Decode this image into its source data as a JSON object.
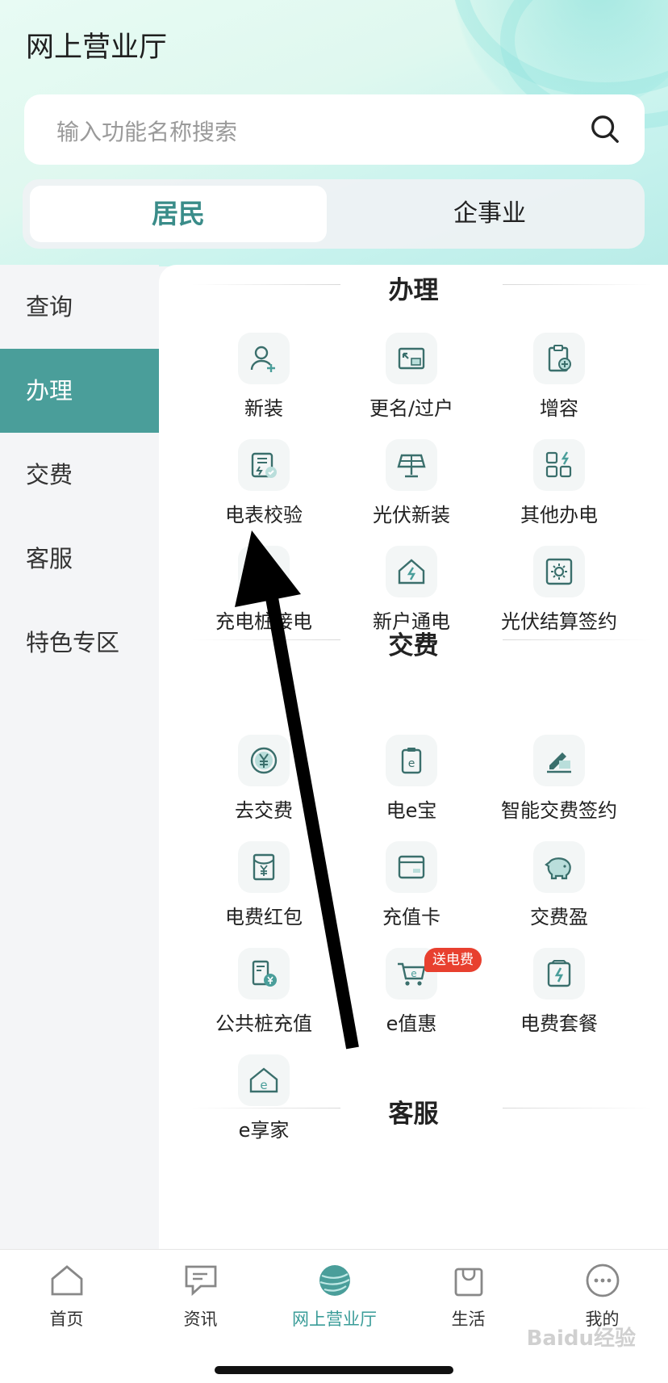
{
  "header": {
    "title": "网上营业厅"
  },
  "search": {
    "placeholder": "输入功能名称搜索"
  },
  "segment": {
    "tabs": [
      "居民",
      "企事业"
    ]
  },
  "sidebar": {
    "items": [
      "查询",
      "办理",
      "交费",
      "客服",
      "特色专区"
    ]
  },
  "sections": {
    "banli": {
      "title": "办理",
      "items": [
        "新装",
        "更名/过户",
        "增容",
        "电表校验",
        "光伏新装",
        "其他办电",
        "充电桩接电",
        "新户通电",
        "光伏结算签约"
      ]
    },
    "jiaofei": {
      "title": "交费",
      "items": [
        "去交费",
        "电e宝",
        "智能交费签约",
        "电费红包",
        "充值卡",
        "交费盈",
        "公共桩充值",
        "e值惠",
        "电费套餐",
        "e享家"
      ],
      "badge": "送电费"
    },
    "kefu": {
      "title": "客服"
    }
  },
  "tabbar": {
    "items": [
      "首页",
      "资讯",
      "网上营业厅",
      "生活",
      "我的"
    ]
  },
  "watermark": "Baidu经验",
  "colors": {
    "accent": "#4a9e9a",
    "badge": "#e8402f"
  }
}
